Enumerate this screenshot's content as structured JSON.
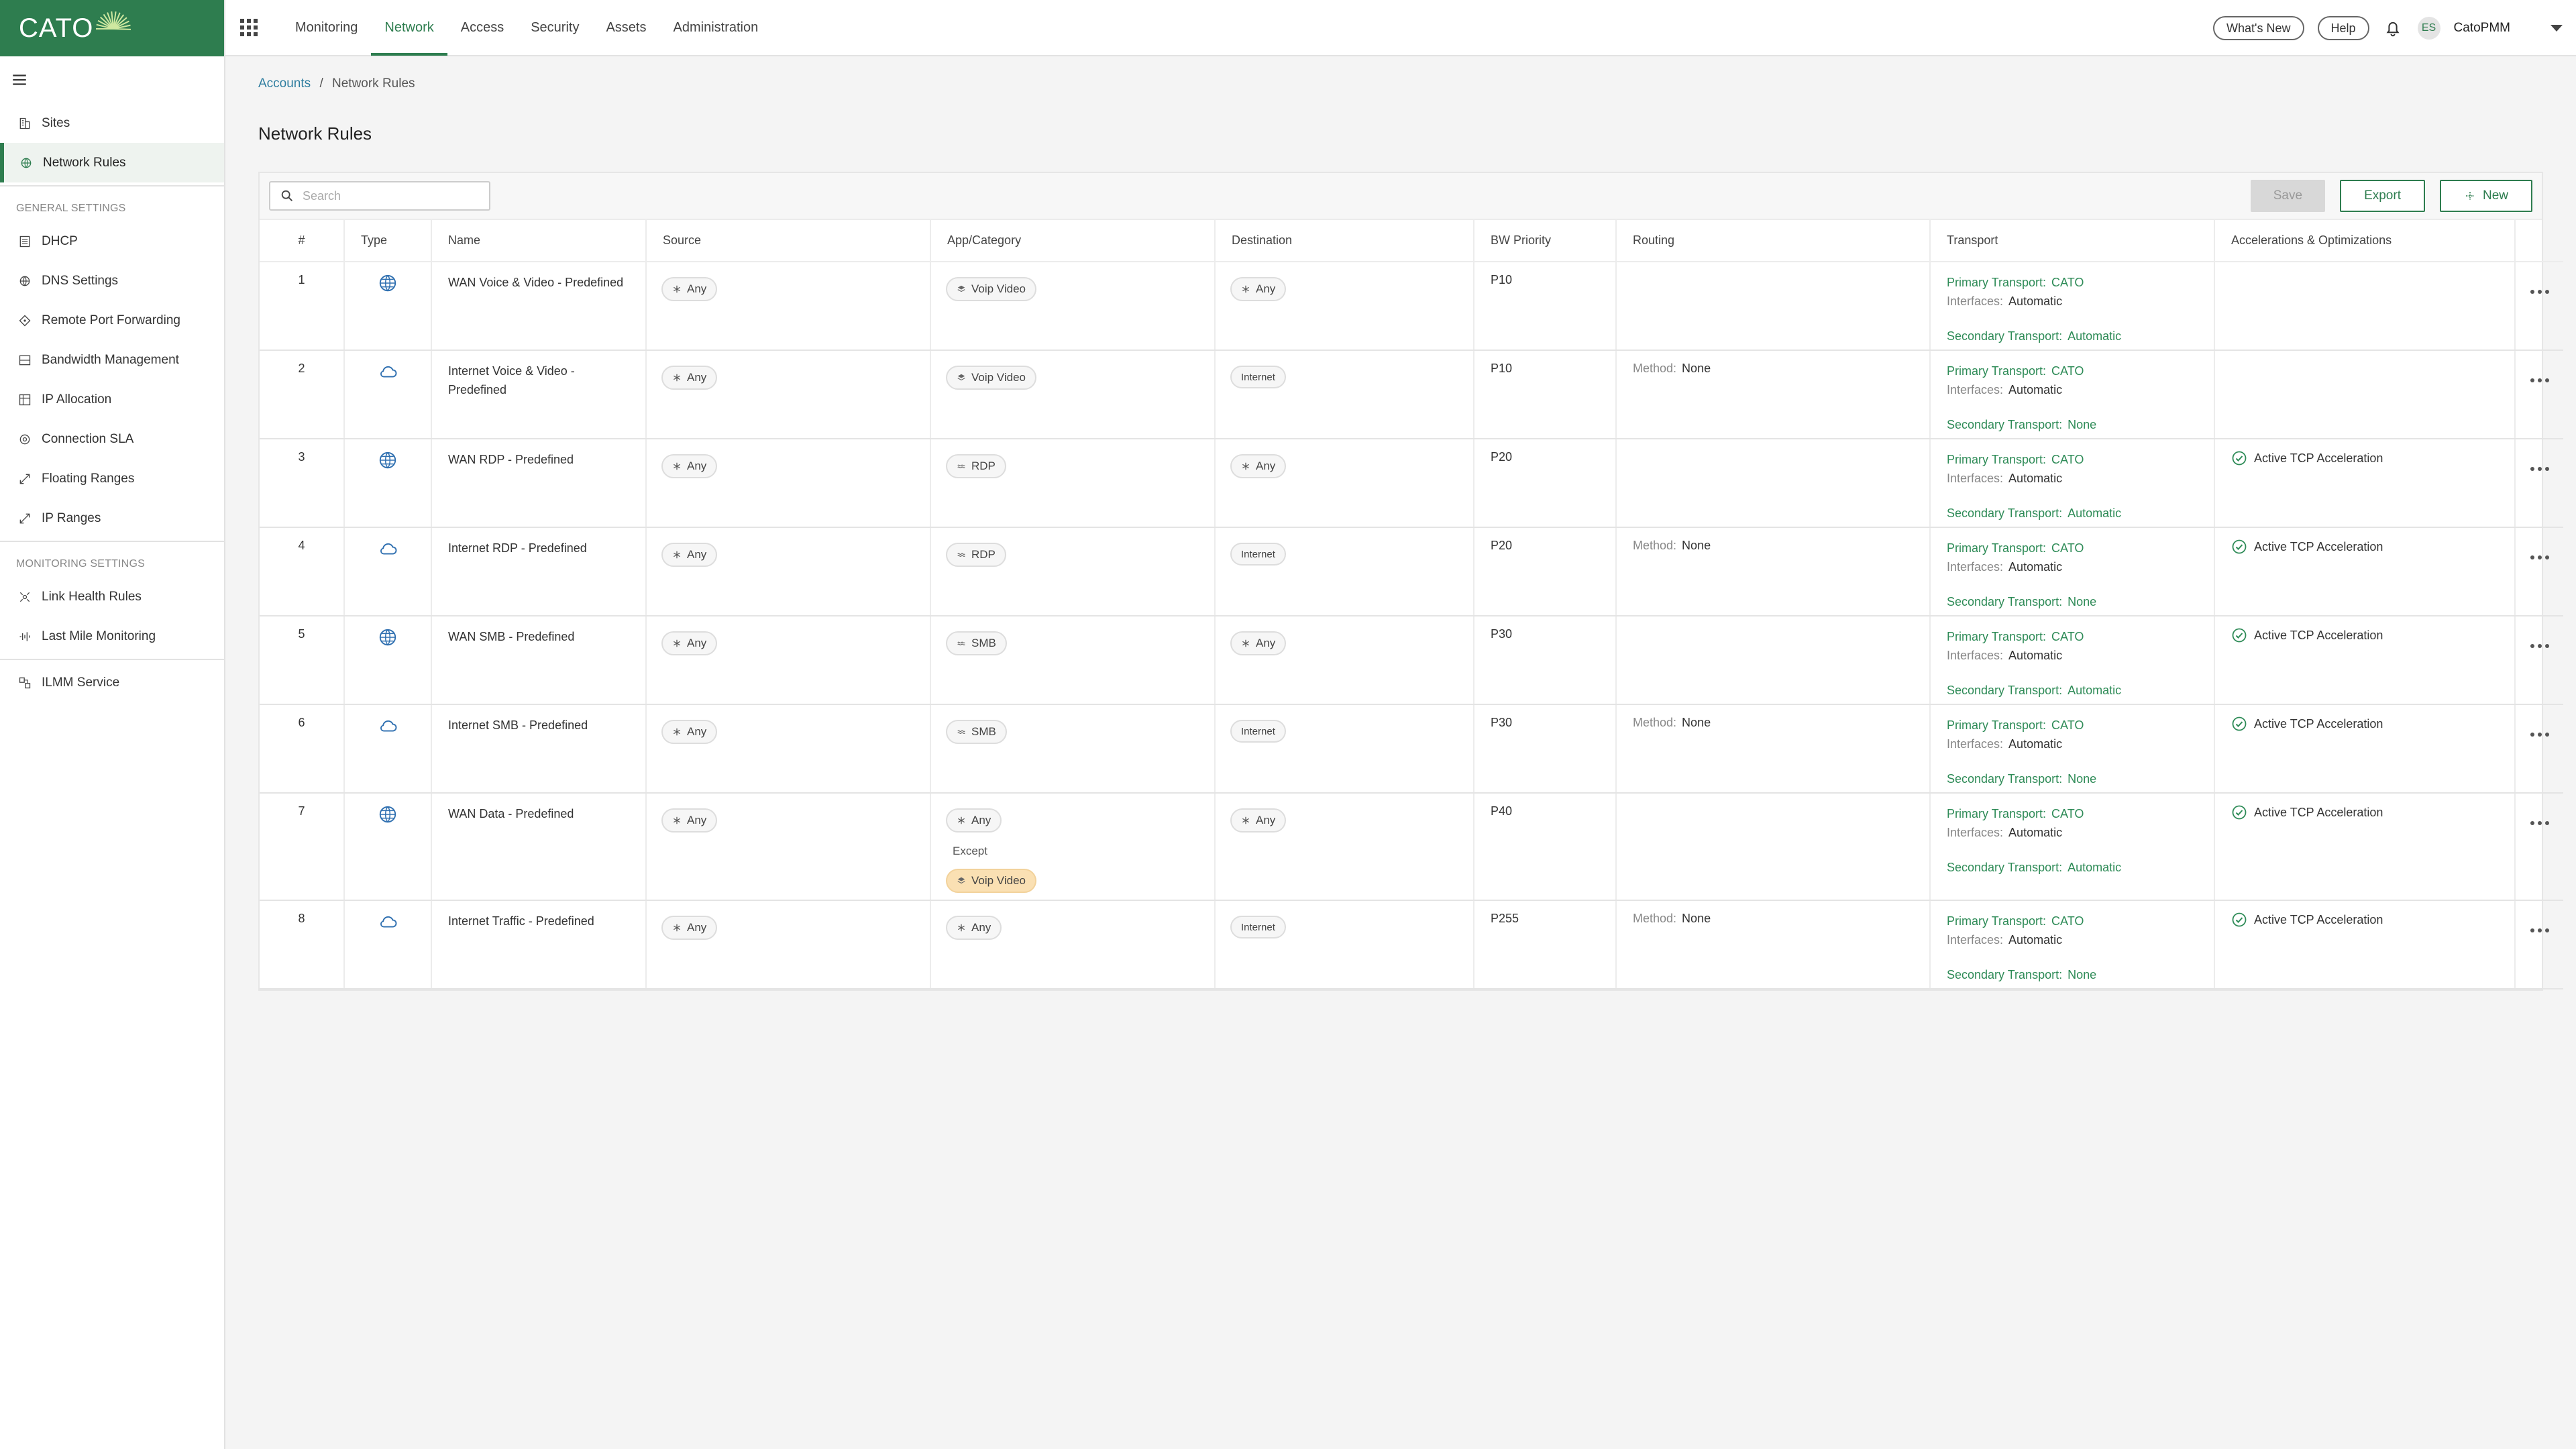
{
  "logo": {
    "text": "CATO"
  },
  "topnav": {
    "tabs": [
      "Monitoring",
      "Network",
      "Access",
      "Security",
      "Assets",
      "Administration"
    ],
    "whats_new": "What's New",
    "help": "Help",
    "avatar_initials": "ES",
    "account": "CatoPMM"
  },
  "sidebar": {
    "top_items": [
      {
        "label": "Sites",
        "icon": "sites-icon"
      },
      {
        "label": "Network Rules",
        "icon": "network-rules-icon"
      }
    ],
    "general_heading": "GENERAL SETTINGS",
    "general_items": [
      {
        "label": "DHCP",
        "icon": "dhcp-icon"
      },
      {
        "label": "DNS Settings",
        "icon": "dns-icon"
      },
      {
        "label": "Remote Port Forwarding",
        "icon": "port-forwarding-icon"
      },
      {
        "label": "Bandwidth Management",
        "icon": "bandwidth-icon"
      },
      {
        "label": "IP Allocation",
        "icon": "ip-allocation-icon"
      },
      {
        "label": "Connection SLA",
        "icon": "sla-icon"
      },
      {
        "label": "Floating Ranges",
        "icon": "floating-ranges-icon"
      },
      {
        "label": "IP Ranges",
        "icon": "ip-ranges-icon"
      }
    ],
    "monitoring_heading": "MONITORING SETTINGS",
    "monitoring_items": [
      {
        "label": "Link Health Rules",
        "icon": "link-health-icon"
      },
      {
        "label": "Last Mile Monitoring",
        "icon": "last-mile-icon"
      }
    ],
    "bottom_items": [
      {
        "label": "ILMM Service",
        "icon": "ilmm-icon"
      }
    ]
  },
  "breadcrumb": {
    "root": "Accounts",
    "sep": "/",
    "current": "Network Rules"
  },
  "page_title": "Network Rules",
  "toolbar": {
    "search_placeholder": "Search",
    "save": "Save",
    "export": "Export",
    "new": "New"
  },
  "table": {
    "headers": [
      "#",
      "Type",
      "Name",
      "Source",
      "App/Category",
      "Destination",
      "BW Priority",
      "Routing",
      "Transport",
      "Accelerations & Optimizations"
    ],
    "labels": {
      "primary": "Primary Transport:",
      "interfaces": "Interfaces:",
      "secondary": "Secondary Transport:",
      "method": "Method:",
      "except": "Except"
    },
    "rows": [
      {
        "num": "1",
        "type": "wan",
        "name": "WAN Voice & Video - Predefined",
        "source": "Any",
        "app": "Voip Video",
        "app_icon": "layers",
        "dest": "Any",
        "dest_type": "any",
        "bw": "P10",
        "method": "",
        "primary": "CATO",
        "interfaces": "Automatic",
        "secondary": "Automatic",
        "accel": ""
      },
      {
        "num": "2",
        "type": "internet",
        "name": "Internet Voice & Video - Predefined",
        "source": "Any",
        "app": "Voip Video",
        "app_icon": "layers",
        "dest": "Internet",
        "dest_type": "internet",
        "bw": "P10",
        "method": "None",
        "primary": "CATO",
        "interfaces": "Automatic",
        "secondary": "None",
        "accel": ""
      },
      {
        "num": "3",
        "type": "wan",
        "name": "WAN RDP - Predefined",
        "source": "Any",
        "app": "RDP",
        "app_icon": "wave",
        "dest": "Any",
        "dest_type": "any",
        "bw": "P20",
        "method": "",
        "primary": "CATO",
        "interfaces": "Automatic",
        "secondary": "Automatic",
        "accel": "Active TCP Acceleration"
      },
      {
        "num": "4",
        "type": "internet",
        "name": "Internet RDP - Predefined",
        "source": "Any",
        "app": "RDP",
        "app_icon": "wave",
        "dest": "Internet",
        "dest_type": "internet",
        "bw": "P20",
        "method": "None",
        "primary": "CATO",
        "interfaces": "Automatic",
        "secondary": "None",
        "accel": "Active TCP Acceleration"
      },
      {
        "num": "5",
        "type": "wan",
        "name": "WAN SMB - Predefined",
        "source": "Any",
        "app": "SMB",
        "app_icon": "wave",
        "dest": "Any",
        "dest_type": "any",
        "bw": "P30",
        "method": "",
        "primary": "CATO",
        "interfaces": "Automatic",
        "secondary": "Automatic",
        "accel": "Active TCP Acceleration"
      },
      {
        "num": "6",
        "type": "internet",
        "name": "Internet SMB - Predefined",
        "source": "Any",
        "app": "SMB",
        "app_icon": "wave",
        "dest": "Internet",
        "dest_type": "internet",
        "bw": "P30",
        "method": "None",
        "primary": "CATO",
        "interfaces": "Automatic",
        "secondary": "None",
        "accel": "Active TCP Acceleration"
      },
      {
        "num": "7",
        "type": "wan",
        "name": "WAN Data - Predefined",
        "source": "Any",
        "app": "Any",
        "app_icon": "any",
        "except": "Voip Video",
        "dest": "Any",
        "dest_type": "any",
        "bw": "P40",
        "method": "",
        "primary": "CATO",
        "interfaces": "Automatic",
        "secondary": "Automatic",
        "accel": "Active TCP Acceleration"
      },
      {
        "num": "8",
        "type": "internet",
        "name": "Internet Traffic - Predefined",
        "source": "Any",
        "app": "Any",
        "app_icon": "any",
        "dest": "Internet",
        "dest_type": "internet",
        "bw": "P255",
        "method": "None",
        "primary": "CATO",
        "interfaces": "Automatic",
        "secondary": "None",
        "accel": "Active TCP Acceleration"
      }
    ]
  },
  "colors": {
    "brand": "#2e7d4f",
    "link": "#2e7d9f",
    "transport_green": "#2e8b57",
    "except_chip": "#fae0b3"
  }
}
